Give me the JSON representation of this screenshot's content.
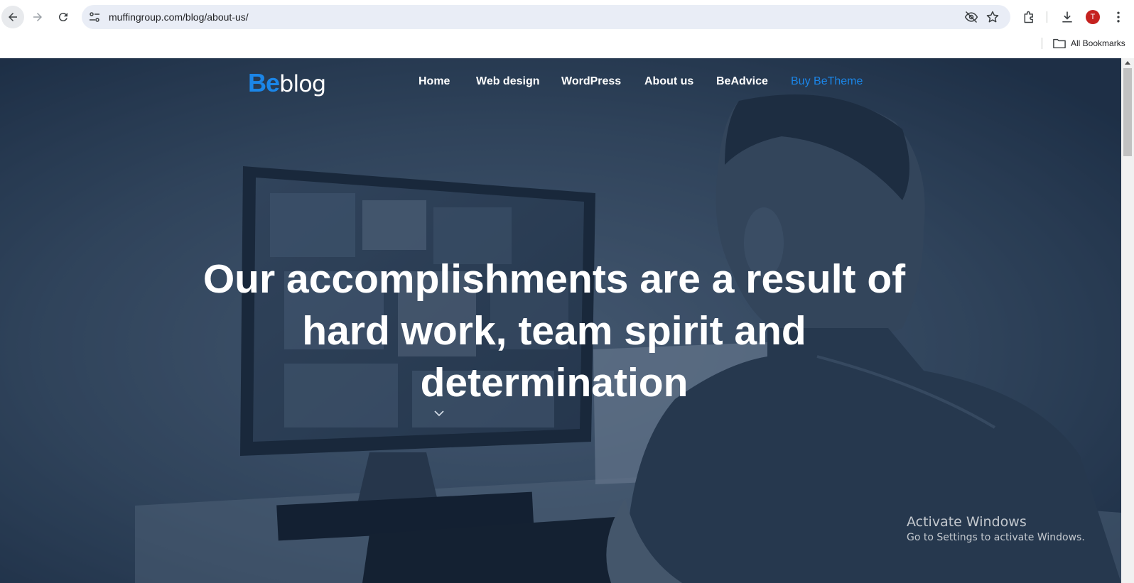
{
  "browser": {
    "url": "muffingroup.com/blog/about-us/",
    "profile_initial": "T",
    "bookmarks_label": "All Bookmarks",
    "icons": [
      "back-arrow-icon",
      "forward-arrow-icon",
      "reload-icon",
      "site-settings-icon",
      "eye-off-icon",
      "star-icon",
      "extensions-icon",
      "download-icon",
      "more-vert-icon",
      "folder-icon"
    ]
  },
  "site": {
    "brand_be": "Be",
    "brand_blog": "blog",
    "menu": [
      "Home",
      "Web design",
      "WordPress",
      "About us",
      "BeAdvice",
      "Buy BeTheme"
    ],
    "accent_color": "#1b86e8"
  },
  "hero": {
    "headline": "Our accomplishments are a result of hard work, team spirit and determination"
  },
  "watermark": {
    "title": "Activate Windows",
    "subtitle": "Go to Settings to activate Windows."
  }
}
